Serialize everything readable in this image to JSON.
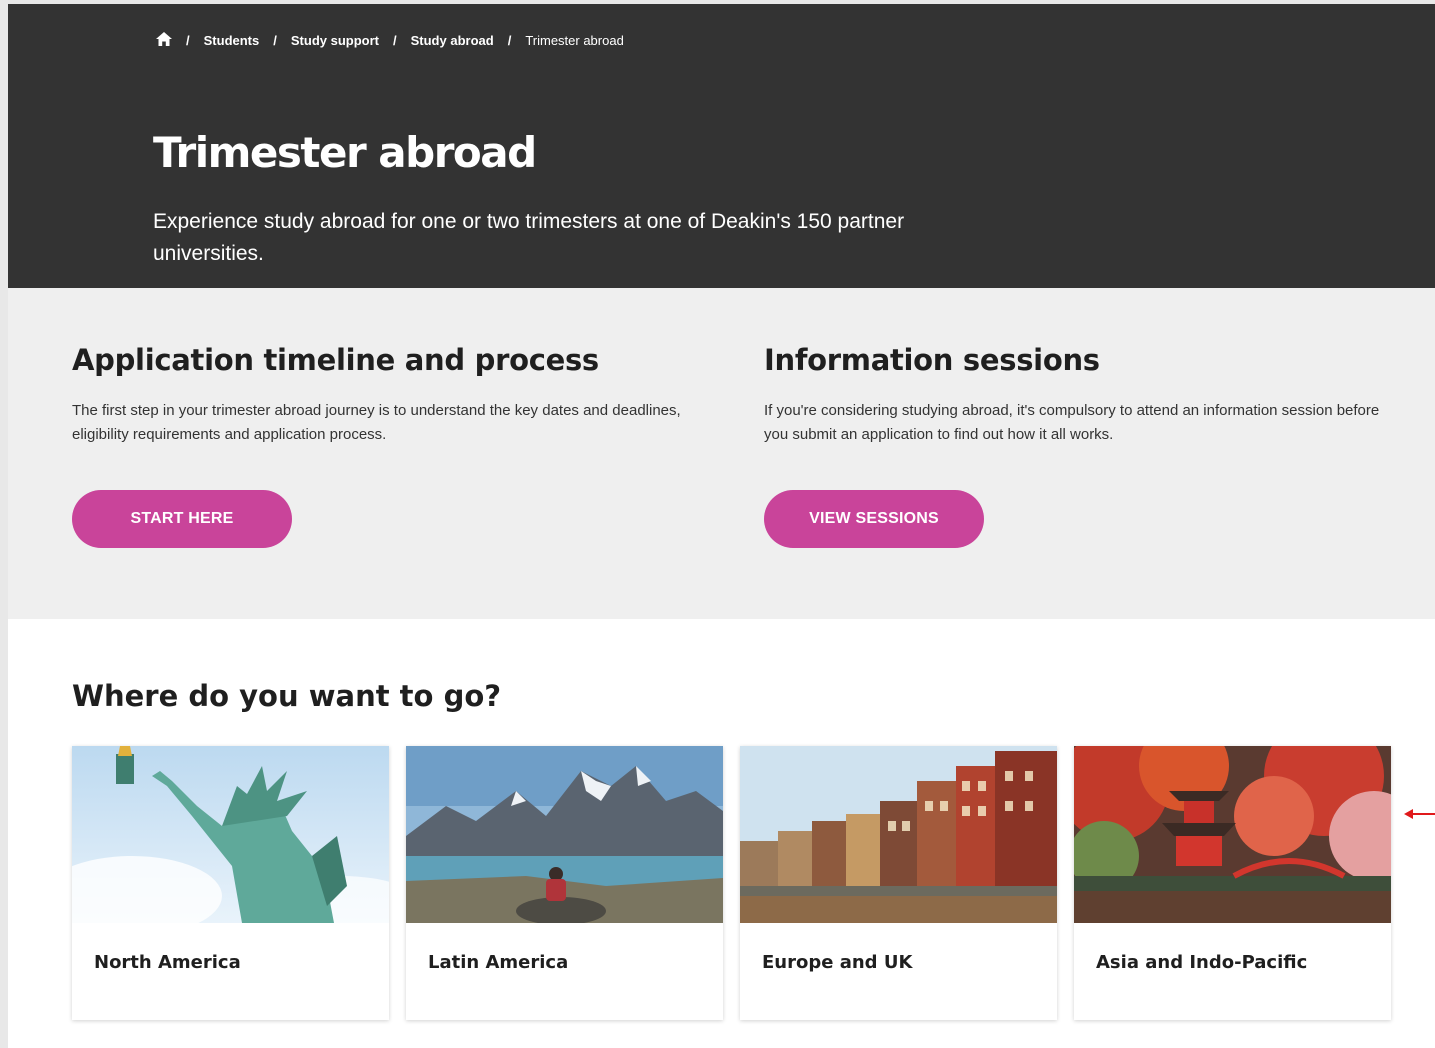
{
  "breadcrumb": {
    "home_icon": "home-icon",
    "items": [
      "Students",
      "Study support",
      "Study abroad"
    ],
    "current": "Trimester abroad",
    "separator": "/"
  },
  "hero": {
    "title": "Trimester abroad",
    "intro": "Experience study abroad for one or two trimesters at one of Deakin's 150 partner universities.",
    "background": "#333333"
  },
  "application": {
    "heading": "Application timeline and process",
    "body": "The first step in your trimester abroad journey is to understand the key dates and deadlines, eligibility requirements and application process.",
    "button_label": "START HERE"
  },
  "sessions": {
    "heading": "Information sessions",
    "body": "If you're considering studying abroad, it's compulsory to attend an information session before you submit an application to find out how it all works.",
    "button_label": "VIEW SESSIONS"
  },
  "destinations": {
    "heading": "Where do you want to go?",
    "cards": [
      {
        "label": "North America",
        "image": "statue-of-liberty-image"
      },
      {
        "label": "Latin America",
        "image": "patagonia-mountains-image"
      },
      {
        "label": "Europe and UK",
        "image": "amsterdam-canal-houses-image"
      },
      {
        "label": "Asia and Indo-Pacific",
        "image": "japanese-pagoda-autumn-image"
      }
    ]
  },
  "colors": {
    "accent": "#c9449a",
    "hero_bg": "#333333",
    "band_bg": "#efefef",
    "annotation_arrow": "#e0191b"
  }
}
